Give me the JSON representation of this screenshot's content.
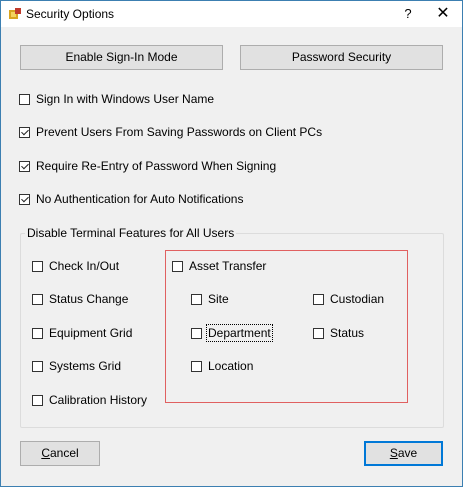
{
  "window": {
    "title": "Security Options",
    "help": "?",
    "close": "✕"
  },
  "buttons": {
    "enable_signin": "Enable Sign-In Mode",
    "password_security": "Password Security",
    "cancel_u": "C",
    "cancel_rest": "ancel",
    "save_u": "S",
    "save_rest": "ave"
  },
  "options": [
    {
      "label": "Sign In with Windows User Name",
      "checked": false
    },
    {
      "label": "Prevent Users From Saving Passwords on Client PCs",
      "checked": true
    },
    {
      "label": "Require Re-Entry of Password When Signing",
      "checked": true
    },
    {
      "label": "No Authentication for Auto Notifications",
      "checked": true
    }
  ],
  "group": {
    "label": "Disable Terminal Features for All Users",
    "left_items": [
      {
        "label": "Check In/Out",
        "checked": false
      },
      {
        "label": "Status Change",
        "checked": false
      },
      {
        "label": "Equipment Grid",
        "checked": false
      },
      {
        "label": "Systems Grid",
        "checked": false
      },
      {
        "label": "Calibration History",
        "checked": false
      }
    ],
    "asset_transfer": {
      "label": "Asset Transfer",
      "checked": false
    },
    "sub_items": [
      {
        "label": "Site",
        "checked": false
      },
      {
        "label": "Custodian",
        "checked": false
      },
      {
        "label": "Department",
        "checked": false
      },
      {
        "label": "Status",
        "checked": false
      },
      {
        "label": "Location",
        "checked": false
      }
    ]
  }
}
